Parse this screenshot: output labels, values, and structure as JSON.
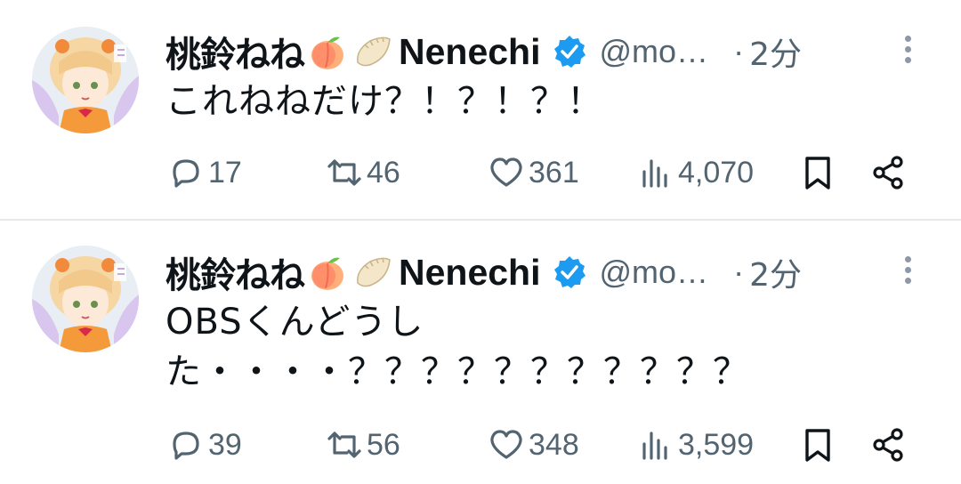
{
  "tweets": [
    {
      "author": {
        "name_jp": "桃鈴ねね",
        "name_latin": "Nenechi",
        "emoji_1": "peach-emoji",
        "emoji_2": "dumpling-emoji",
        "handle": "@mo…",
        "verified": true
      },
      "separator": "·",
      "time": "2分",
      "text_lines": [
        "これねねだけ？！？！？！"
      ],
      "stats": {
        "replies": "17",
        "retweets": "46",
        "likes": "361",
        "views": "4,070"
      }
    },
    {
      "author": {
        "name_jp": "桃鈴ねね",
        "name_latin": "Nenechi",
        "emoji_1": "peach-emoji",
        "emoji_2": "dumpling-emoji",
        "handle": "@mo…",
        "verified": true
      },
      "separator": "·",
      "time": "2分",
      "text_lines": [
        "OBSくんどうし",
        "た・・・・？？？？？？？？？？？"
      ],
      "stats": {
        "replies": "39",
        "retweets": "56",
        "likes": "348",
        "views": "3,599"
      }
    }
  ],
  "colors": {
    "text_primary": "#0f1419",
    "text_secondary": "#536471",
    "verified_blue": "#1d9bf0",
    "divider": "#e6e9ec"
  },
  "icons": [
    "reply-icon",
    "retweet-icon",
    "like-icon",
    "views-icon",
    "bookmark-icon",
    "share-icon",
    "more-icon",
    "verified-badge-icon"
  ]
}
